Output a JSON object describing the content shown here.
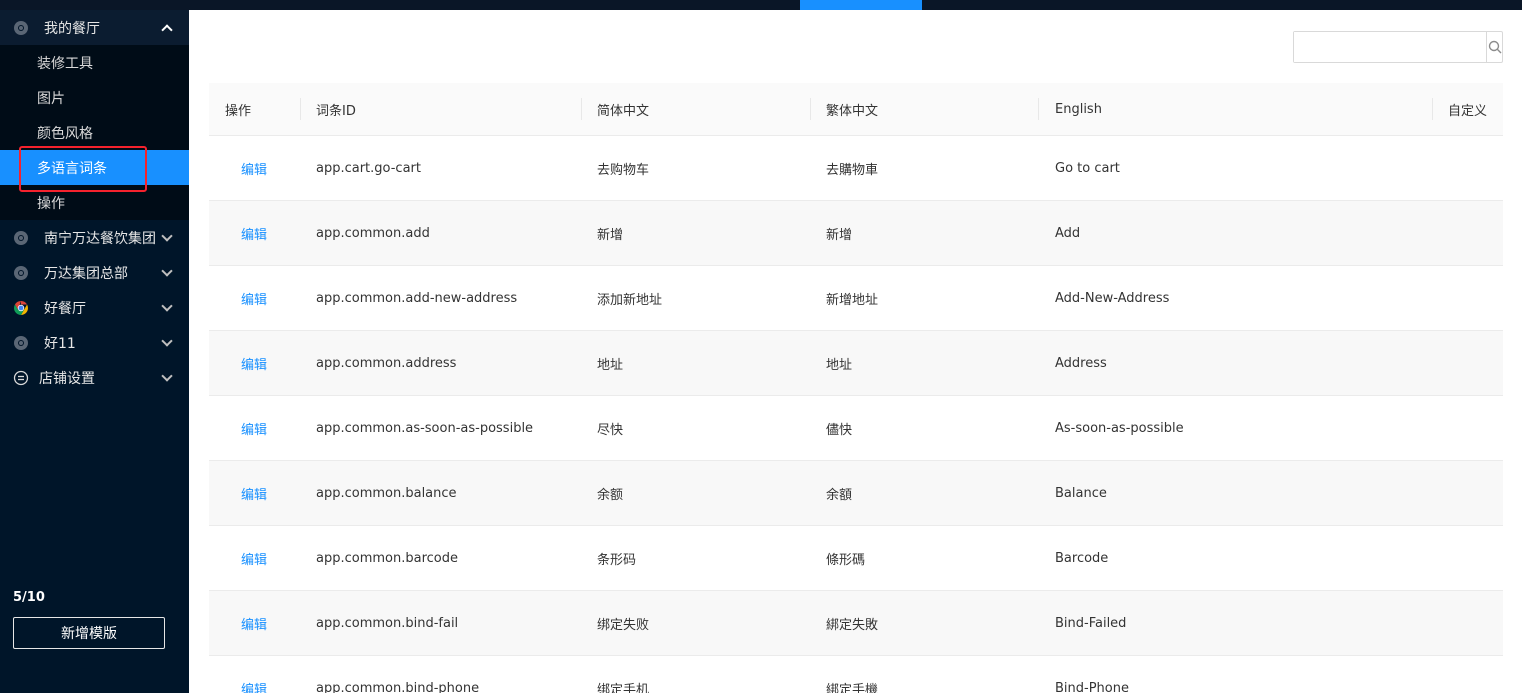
{
  "colors": {
    "sidebar_bg": "#001529",
    "accent": "#1890ff",
    "highlight": "#f5222d"
  },
  "sidebar": {
    "groups": [
      {
        "label": "我的餐厅",
        "icon": "chrome-icon",
        "expanded": true
      },
      {
        "label": "南宁万达餐饮集团",
        "icon": "chrome-icon",
        "expanded": false
      },
      {
        "label": "万达集团总部",
        "icon": "chrome-icon",
        "expanded": false
      },
      {
        "label": "好餐厅",
        "icon": "chrome-color-icon",
        "expanded": false
      },
      {
        "label": "好11",
        "icon": "chrome-icon",
        "expanded": false
      },
      {
        "label": "店铺设置",
        "icon": "menu-circle-icon",
        "expanded": false
      }
    ],
    "sub_items": [
      {
        "label": "装修工具"
      },
      {
        "label": "图片"
      },
      {
        "label": "颜色风格"
      },
      {
        "label": "多语言词条",
        "active": true
      },
      {
        "label": "操作"
      }
    ],
    "usage": "5/10",
    "new_template_label": "新增模版"
  },
  "search": {
    "value": "",
    "placeholder": ""
  },
  "table": {
    "columns": [
      "操作",
      "词条ID",
      "简体中文",
      "繁体中文",
      "English",
      "自定义"
    ],
    "rows": [
      {
        "action": "编辑",
        "id": "app.cart.go-cart",
        "zh_cn": "去购物车",
        "zh_tw": "去購物車",
        "en": "Go to cart",
        "custom": ""
      },
      {
        "action": "编辑",
        "id": "app.common.add",
        "zh_cn": "新增",
        "zh_tw": "新增",
        "en": "Add",
        "custom": ""
      },
      {
        "action": "编辑",
        "id": "app.common.add-new-address",
        "zh_cn": "添加新地址",
        "zh_tw": "新增地址",
        "en": "Add-New-Address",
        "custom": ""
      },
      {
        "action": "编辑",
        "id": "app.common.address",
        "zh_cn": "地址",
        "zh_tw": "地址",
        "en": "Address",
        "custom": ""
      },
      {
        "action": "编辑",
        "id": "app.common.as-soon-as-possible",
        "zh_cn": "尽快",
        "zh_tw": "儘快",
        "en": "As-soon-as-possible",
        "custom": ""
      },
      {
        "action": "编辑",
        "id": "app.common.balance",
        "zh_cn": "余额",
        "zh_tw": "余額",
        "en": "Balance",
        "custom": ""
      },
      {
        "action": "编辑",
        "id": "app.common.barcode",
        "zh_cn": "条形码",
        "zh_tw": "條形碼",
        "en": "Barcode",
        "custom": ""
      },
      {
        "action": "编辑",
        "id": "app.common.bind-fail",
        "zh_cn": "绑定失败",
        "zh_tw": "綁定失敗",
        "en": "Bind-Failed",
        "custom": ""
      },
      {
        "action": "编辑",
        "id": "app.common.bind-phone",
        "zh_cn": "绑定手机",
        "zh_tw": "綁定手機",
        "en": "Bind-Phone",
        "custom": ""
      }
    ]
  }
}
